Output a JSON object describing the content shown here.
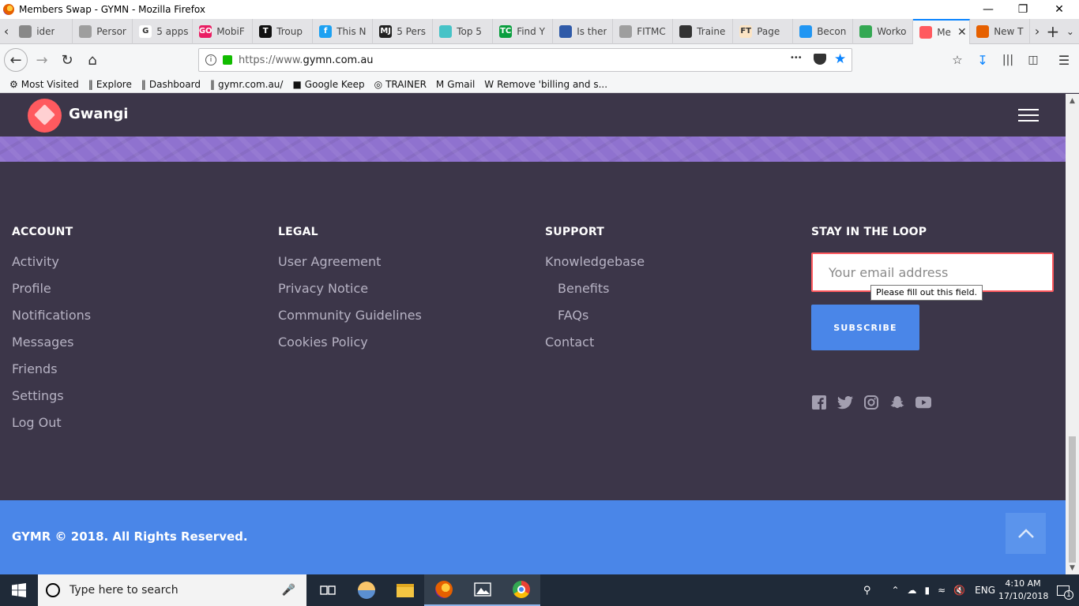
{
  "window": {
    "title": "Members Swap - GYMN - Mozilla Firefox",
    "controls": {
      "minimize": "—",
      "restore": "❐",
      "close": "✕"
    }
  },
  "tabs": [
    {
      "label": "ider",
      "color": "#888888",
      "glyph": ""
    },
    {
      "label": "Persor",
      "color": "#9e9e9e",
      "glyph": ""
    },
    {
      "label": "5 apps",
      "color": "#ffffff",
      "glyph": "G"
    },
    {
      "label": "MobiF",
      "color": "#e91e63",
      "glyph": "GO"
    },
    {
      "label": "Troup",
      "color": "#111111",
      "glyph": "T"
    },
    {
      "label": "This N",
      "color": "#1da1f2",
      "glyph": "f"
    },
    {
      "label": "5 Pers",
      "color": "#222222",
      "glyph": "MJ"
    },
    {
      "label": "Top 5",
      "color": "#46c3c7",
      "glyph": ""
    },
    {
      "label": "Find Y",
      "color": "#0a9e3f",
      "glyph": "TC"
    },
    {
      "label": "Is ther",
      "color": "#2f5aa8",
      "glyph": ""
    },
    {
      "label": "FITMC",
      "color": "#9e9e9e",
      "glyph": ""
    },
    {
      "label": "Traine",
      "color": "#333333",
      "glyph": ""
    },
    {
      "label": "Page",
      "color": "#fce4c4",
      "glyph": "FT"
    },
    {
      "label": "Becon",
      "color": "#2196f3",
      "glyph": ""
    },
    {
      "label": "Worko",
      "color": "#34a853",
      "glyph": ""
    },
    {
      "label": "Me",
      "color": "#ff5a5f",
      "glyph": "",
      "active": true
    },
    {
      "label": "New T",
      "color": "#e66000",
      "glyph": ""
    }
  ],
  "nav": {
    "url_prefix": "https://www.",
    "url_domain": "gymn.com.au",
    "more_glyph": "•••"
  },
  "bookmarks": [
    {
      "icon": "⚙",
      "label": "Most Visited"
    },
    {
      "icon": "‖",
      "label": "Explore"
    },
    {
      "icon": "‖",
      "label": "Dashboard"
    },
    {
      "icon": "‖",
      "label": "gymr.com.au/"
    },
    {
      "icon": "■",
      "label": "Google Keep"
    },
    {
      "icon": "◎",
      "label": "TRAINER"
    },
    {
      "icon": "M",
      "label": "Gmail"
    },
    {
      "icon": "W",
      "label": "Remove 'billing and s..."
    }
  ],
  "site": {
    "brand": "Gwangi",
    "colors": {
      "bg": "#3c3649",
      "accent": "#ff5a5f",
      "band": "#8f72cf",
      "primary": "#4a86e8"
    }
  },
  "footer": {
    "account": {
      "heading": "ACCOUNT",
      "items": [
        "Activity",
        "Profile",
        "Notifications",
        "Messages",
        "Friends",
        "Settings",
        "Log Out"
      ]
    },
    "legal": {
      "heading": "LEGAL",
      "items": [
        "User Agreement",
        "Privacy Notice",
        "Community Guidelines",
        "Cookies Policy"
      ]
    },
    "support": {
      "heading": "SUPPORT",
      "items": [
        "Knowledgebase",
        "Benefits",
        "FAQs",
        "Contact"
      ]
    },
    "newsletter": {
      "heading": "STAY IN THE LOOP",
      "placeholder": "Your email address",
      "tooltip": "Please fill out this field.",
      "button": "SUBSCRIBE"
    },
    "socials": [
      "facebook-icon",
      "twitter-icon",
      "instagram-icon",
      "snapchat-icon",
      "youtube-icon"
    ],
    "copyright": "GYMR © 2018. All Rights Reserved."
  },
  "taskbar": {
    "search_placeholder": "Type here to search",
    "language": "ENG",
    "time": "4:10 AM",
    "date": "17/10/2018",
    "notifications": "1"
  }
}
